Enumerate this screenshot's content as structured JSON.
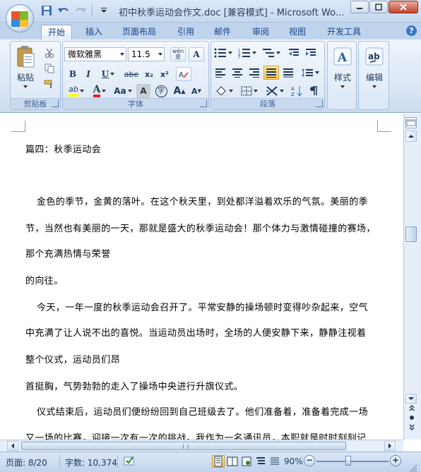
{
  "window": {
    "title": "初中秋季运动会作文.doc [兼容模式] - Microsoft Wo..."
  },
  "tabs": [
    {
      "label": "开始",
      "active": true
    },
    {
      "label": "插入"
    },
    {
      "label": "页面布局"
    },
    {
      "label": "引用"
    },
    {
      "label": "邮件"
    },
    {
      "label": "审阅"
    },
    {
      "label": "视图"
    },
    {
      "label": "开发工具"
    }
  ],
  "ribbon": {
    "clipboard": {
      "group_label": "剪贴板",
      "paste_label": "粘贴"
    },
    "font": {
      "group_label": "字体",
      "font_name": "微软雅黑",
      "font_size": "11.5",
      "wen_label": "wén 变",
      "a_box_label": "A",
      "bold": "B",
      "italic": "I",
      "underline": "U",
      "strikethrough": "abe",
      "subscript": "x₂",
      "superscript": "x²",
      "change_case": "Aa",
      "char_shading": "A",
      "enclose": "字",
      "grow": "A",
      "shrink": "A",
      "highlight": "ab",
      "font_color": "A",
      "highlight_color": "#ffff00",
      "font_color_value": "#e02020"
    },
    "paragraph": {
      "group_label": "段落"
    },
    "styles": {
      "label": "样式"
    },
    "editing": {
      "label": "编辑"
    }
  },
  "document": {
    "lines": [
      "篇四：秋季运动会",
      "金色的季节，金黄的落叶。在这个秋天里，到处都洋溢着欢乐的气氛。美丽的季",
      "节，当然也有美丽的一天，那就是盛大的秋季运动会！那个体力与激情碰撞的赛场，",
      "那个充满热情与荣誉",
      "的向往。",
      "今天，一年一度的秋季运动会召开了。平常安静的操场顿时变得吵杂起来，空气",
      "中充满了让人说不出的喜悦。当运动员出场时，全场的人便安静下来，静静注视着",
      "整个仪式，运动员们昂",
      "首挺胸，气势勃勃的走入了操场中央进行升旗仪式。",
      "仪式结束后，运动员们便纷纷回到自己班级去了。他们准备着，准备着完成一场",
      "又一场的比赛，迎接一次有一次的挑战。我作为一名通讯员，本职就是时时刻刻记"
    ]
  },
  "statusbar": {
    "page": "页面: 8/20",
    "words": "字数: 10,374",
    "zoom": "90%",
    "zoom_value": 90
  }
}
